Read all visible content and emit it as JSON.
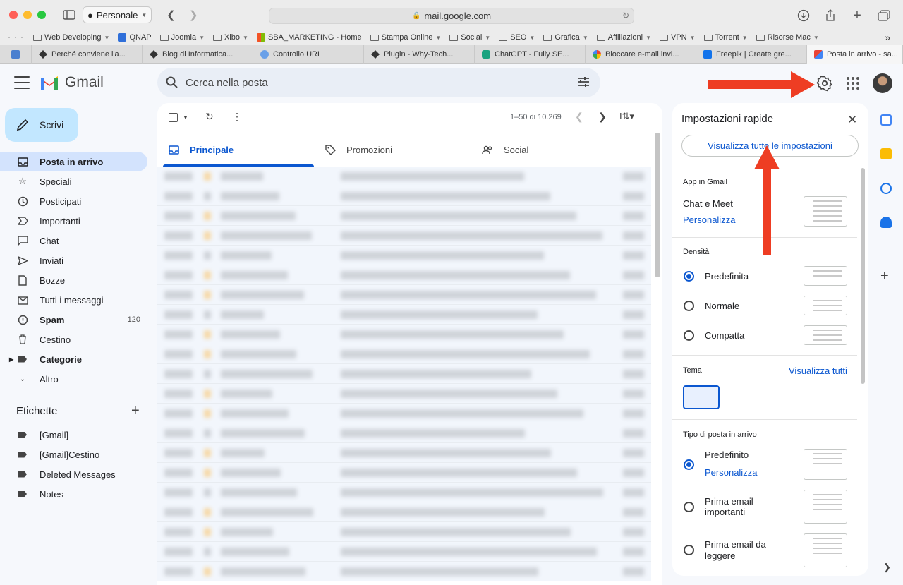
{
  "browser": {
    "profile": "Personale",
    "url": "mail.google.com",
    "bookmarks": [
      {
        "label": "Web Developing",
        "menu": true
      },
      {
        "label": "QNAP",
        "menu": false
      },
      {
        "label": "Joomla",
        "menu": true
      },
      {
        "label": "Xibo",
        "menu": true
      },
      {
        "label": "SBA_MARKETING - Home",
        "menu": false
      },
      {
        "label": "Stampa Online",
        "menu": true
      },
      {
        "label": "Social",
        "menu": true
      },
      {
        "label": "SEO",
        "menu": true
      },
      {
        "label": "Grafica",
        "menu": true
      },
      {
        "label": "Affiliazioni",
        "menu": true
      },
      {
        "label": "VPN",
        "menu": true
      },
      {
        "label": "Torrent",
        "menu": true
      },
      {
        "label": "Risorse Mac",
        "menu": true
      }
    ],
    "tabs": [
      {
        "label": "Perché conviene l'a..."
      },
      {
        "label": "Blog di Informatica..."
      },
      {
        "label": "Controllo URL"
      },
      {
        "label": "Plugin - Why-Tech..."
      },
      {
        "label": "ChatGPT - Fully SE..."
      },
      {
        "label": "Bloccare e-mail invi..."
      },
      {
        "label": "Freepik | Create gre..."
      },
      {
        "label": "Posta in arrivo - sa..."
      }
    ]
  },
  "gmail": {
    "logo_text": "Gmail",
    "search_placeholder": "Cerca nella posta",
    "compose_label": "Scrivi",
    "nav": [
      {
        "label": "Posta in arrivo",
        "icon": "inbox-icon"
      },
      {
        "label": "Speciali",
        "icon": "star-icon"
      },
      {
        "label": "Posticipati",
        "icon": "clock-icon"
      },
      {
        "label": "Importanti",
        "icon": "important-icon"
      },
      {
        "label": "Chat",
        "icon": "chat-icon"
      },
      {
        "label": "Inviati",
        "icon": "send-icon"
      },
      {
        "label": "Bozze",
        "icon": "draft-icon"
      },
      {
        "label": "Tutti i messaggi",
        "icon": "all-mail-icon"
      },
      {
        "label": "Spam",
        "icon": "spam-icon",
        "count": "120"
      },
      {
        "label": "Cestino",
        "icon": "trash-icon"
      },
      {
        "label": "Categorie",
        "icon": "label-icon"
      },
      {
        "label": "Altro",
        "icon": "chevron-down-icon"
      }
    ],
    "labels_title": "Etichette",
    "labels": [
      {
        "label": "[Gmail]"
      },
      {
        "label": "[Gmail]Cestino"
      },
      {
        "label": "Deleted Messages"
      },
      {
        "label": "Notes"
      }
    ],
    "pager": "1–50 di 10.269",
    "mail_tabs": [
      {
        "label": "Principale"
      },
      {
        "label": "Promozioni"
      },
      {
        "label": "Social"
      }
    ]
  },
  "quick_settings": {
    "title": "Impostazioni rapide",
    "see_all": "Visualizza tutte le impostazioni",
    "apps_heading": "App in Gmail",
    "chat_meet": "Chat e Meet",
    "customize": "Personalizza",
    "density_heading": "Densità",
    "density_options": [
      "Predefinita",
      "Normale",
      "Compatta"
    ],
    "theme_heading": "Tema",
    "theme_view_all": "Visualizza tutti",
    "inbox_type_heading": "Tipo di posta in arrivo",
    "inbox_default": "Predefinito",
    "inbox_customize": "Personalizza",
    "inbox_important_1": "Prima email",
    "inbox_important_2": "importanti",
    "inbox_unread_1": "Prima email da",
    "inbox_unread_2": "leggere"
  },
  "colors": {
    "accent": "#0b57d0",
    "annotation_arrow": "#ee3d23",
    "nav_active": "#d3e3fd",
    "compose": "#c2e7ff"
  }
}
